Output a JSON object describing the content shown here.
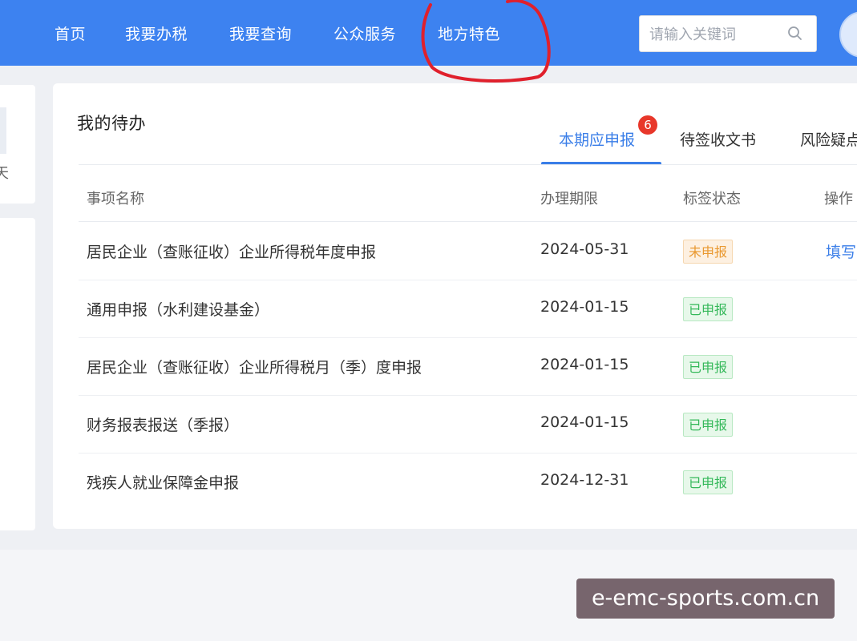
{
  "nav": {
    "items": [
      {
        "label": "首页"
      },
      {
        "label": "我要办税"
      },
      {
        "label": "我要查询"
      },
      {
        "label": "公众服务"
      },
      {
        "label": "地方特色"
      }
    ],
    "search_placeholder": "请输入关键词",
    "icons": {
      "search": "search-icon",
      "avatar": "user-avatar"
    }
  },
  "sidebar": {
    "partial_text": "天"
  },
  "todo": {
    "title": "我的待办",
    "tabs": [
      {
        "label": "本期应申报",
        "badge": "6",
        "active": true
      },
      {
        "label": "待签收文书",
        "active": false
      },
      {
        "label": "风险疑点",
        "active": false
      }
    ],
    "columns": [
      "事项名称",
      "办理期限",
      "标签状态",
      "操作"
    ],
    "rows": [
      {
        "name": "居民企业（查账征收）企业所得税年度申报",
        "deadline": "2024-05-31",
        "status": "未申报",
        "status_kind": "pending",
        "action": "填写"
      },
      {
        "name": "通用申报（水利建设基金）",
        "deadline": "2024-01-15",
        "status": "已申报",
        "status_kind": "done",
        "action": ""
      },
      {
        "name": "居民企业（查账征收）企业所得税月（季）度申报",
        "deadline": "2024-01-15",
        "status": "已申报",
        "status_kind": "done",
        "action": ""
      },
      {
        "name": "财务报表报送（季报）",
        "deadline": "2024-01-15",
        "status": "已申报",
        "status_kind": "done",
        "action": ""
      },
      {
        "name": "残疾人就业保障金申报",
        "deadline": "2024-12-31",
        "status": "已申报",
        "status_kind": "done",
        "action": ""
      }
    ]
  },
  "watermark": "e-emc-sports.com.cn",
  "colors": {
    "header": "#3d82f0",
    "accent": "#3a7ee8",
    "badge": "#e8372a",
    "pending": "#e9982f",
    "done": "#34b859",
    "marker": "#e0202c"
  }
}
